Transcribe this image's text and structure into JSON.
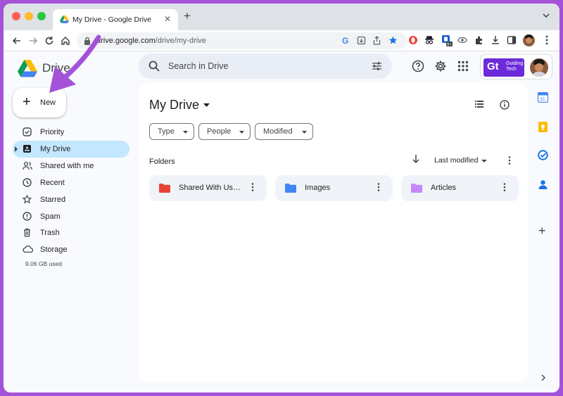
{
  "browser": {
    "tab_title": "My Drive - Google Drive",
    "url_host": "drive.google.com",
    "url_path": "/drive/my-drive"
  },
  "header": {
    "app_name": "Drive",
    "search_placeholder": "Search in Drive",
    "account_brand_line1": "Guiding",
    "account_brand_line2": "Tech"
  },
  "sidebar": {
    "new_label": "New",
    "items": [
      {
        "label": "Priority",
        "icon": "priority-icon"
      },
      {
        "label": "My Drive",
        "icon": "my-drive-icon"
      },
      {
        "label": "Shared with me",
        "icon": "shared-icon"
      },
      {
        "label": "Recent",
        "icon": "clock-icon"
      },
      {
        "label": "Starred",
        "icon": "star-icon"
      },
      {
        "label": "Spam",
        "icon": "spam-icon"
      },
      {
        "label": "Trash",
        "icon": "trash-icon"
      },
      {
        "label": "Storage",
        "icon": "cloud-icon"
      }
    ],
    "storage_used": "9.06 GB used"
  },
  "main": {
    "title": "My Drive",
    "filters": [
      "Type",
      "People",
      "Modified"
    ],
    "folders_heading": "Folders",
    "sort_label": "Last modified",
    "folders": [
      {
        "name": "Shared With Use...",
        "color": "#ea4335"
      },
      {
        "name": "Images",
        "color": "#4285f4"
      },
      {
        "name": "Articles",
        "color": "#c58af9"
      }
    ]
  },
  "colors": {
    "active_nav": "#c2e7ff",
    "accent_purple": "#a453d8"
  }
}
